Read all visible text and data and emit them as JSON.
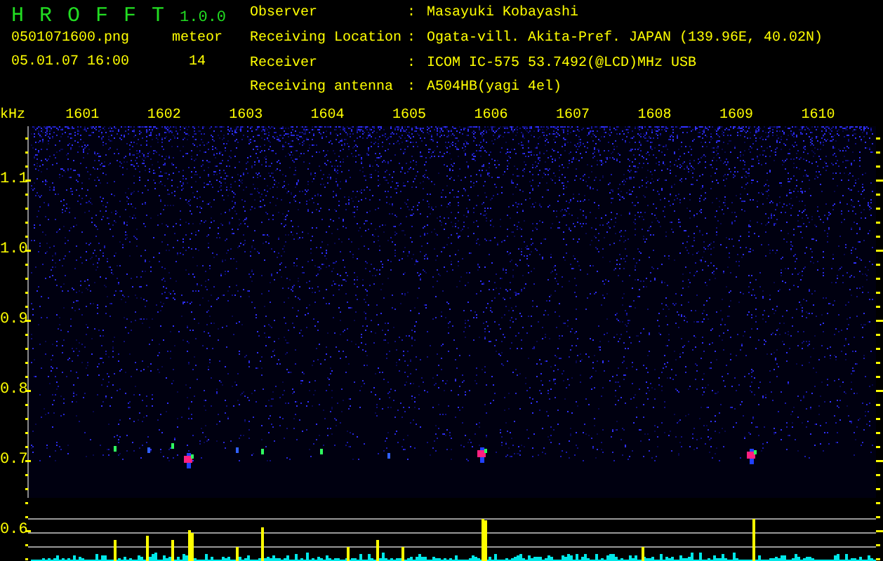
{
  "app": {
    "name": "H R O F F T",
    "version": "1.0.0"
  },
  "file": {
    "name": "0501071600.png",
    "datetime": "05.01.07 16:00"
  },
  "meteor": {
    "label": "meteor",
    "count": "14"
  },
  "station": [
    {
      "label": "Observer",
      "colon": ":",
      "value": "Masayuki Kobayashi"
    },
    {
      "label": "Receiving Location",
      "colon": ":",
      "value": "Ogata-vill. Akita-Pref. JAPAN (139.96E, 40.02N)"
    },
    {
      "label": "Receiver",
      "colon": ":",
      "value": "ICOM IC-575 53.7492(@LCD)MHz USB"
    },
    {
      "label": "Receiving antenna",
      "colon": ":",
      "value": "A504HB(yagi 4el)"
    }
  ],
  "plot": {
    "unit": "kHz",
    "x_labels": [
      "1601",
      "1602",
      "1603",
      "1604",
      "1605",
      "1606",
      "1607",
      "1608",
      "1609",
      "1610"
    ],
    "y_labels": [
      "1.1",
      "1.0",
      "0.9",
      "0.8",
      "0.7",
      "0.6"
    ]
  }
}
